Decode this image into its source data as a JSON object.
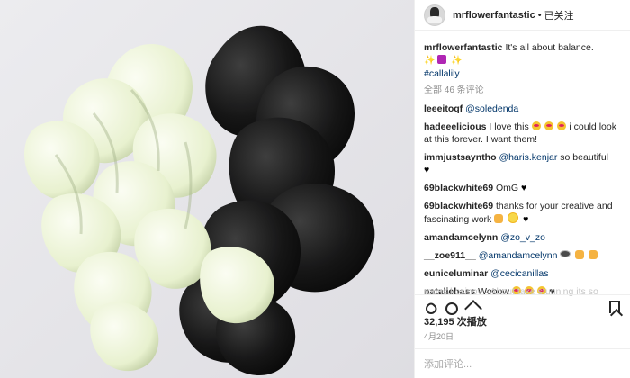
{
  "post": {
    "username": "mrflowerfantastic",
    "follow_separator": "•",
    "follow_label": "已关注",
    "caption_text": "It's all about balance.",
    "caption_hashtag": "#callalily",
    "comments_count": "全部 46 条评论",
    "comments": [
      {
        "user": "leeeitoqf",
        "mention": "@soledenda",
        "text": ""
      },
      {
        "user": "hadeeelicious",
        "text": "I love this",
        "extra_text": "i could look at this forever. I want them!"
      },
      {
        "user": "immjustsayntho",
        "mention": "@haris.kenjar",
        "text": "so beautiful"
      },
      {
        "user": "69blackwhite69",
        "text": "OmG"
      },
      {
        "user": "69blackwhite69",
        "text": "thanks for your creative and fascinating work"
      },
      {
        "user": "amandamcelynn",
        "mention": "@zo_v_zo",
        "text": ""
      },
      {
        "user": "__zoe911__",
        "mention": "@amandamcelynn",
        "text": ""
      },
      {
        "user": "euniceluminar",
        "mention": "@cecicanillas",
        "text": ""
      },
      {
        "user": "nataliehass",
        "text": "Wooow"
      }
    ],
    "partial_comment": "rouns.kosinov · About take stunning its so",
    "likes": "32,195 次播放",
    "date": "4月20日",
    "add_comment_placeholder": "添加评论..."
  },
  "icons": {
    "heart": "heart-icon",
    "comment": "comment-icon",
    "share": "share-icon",
    "bookmark": "bookmark-icon"
  }
}
